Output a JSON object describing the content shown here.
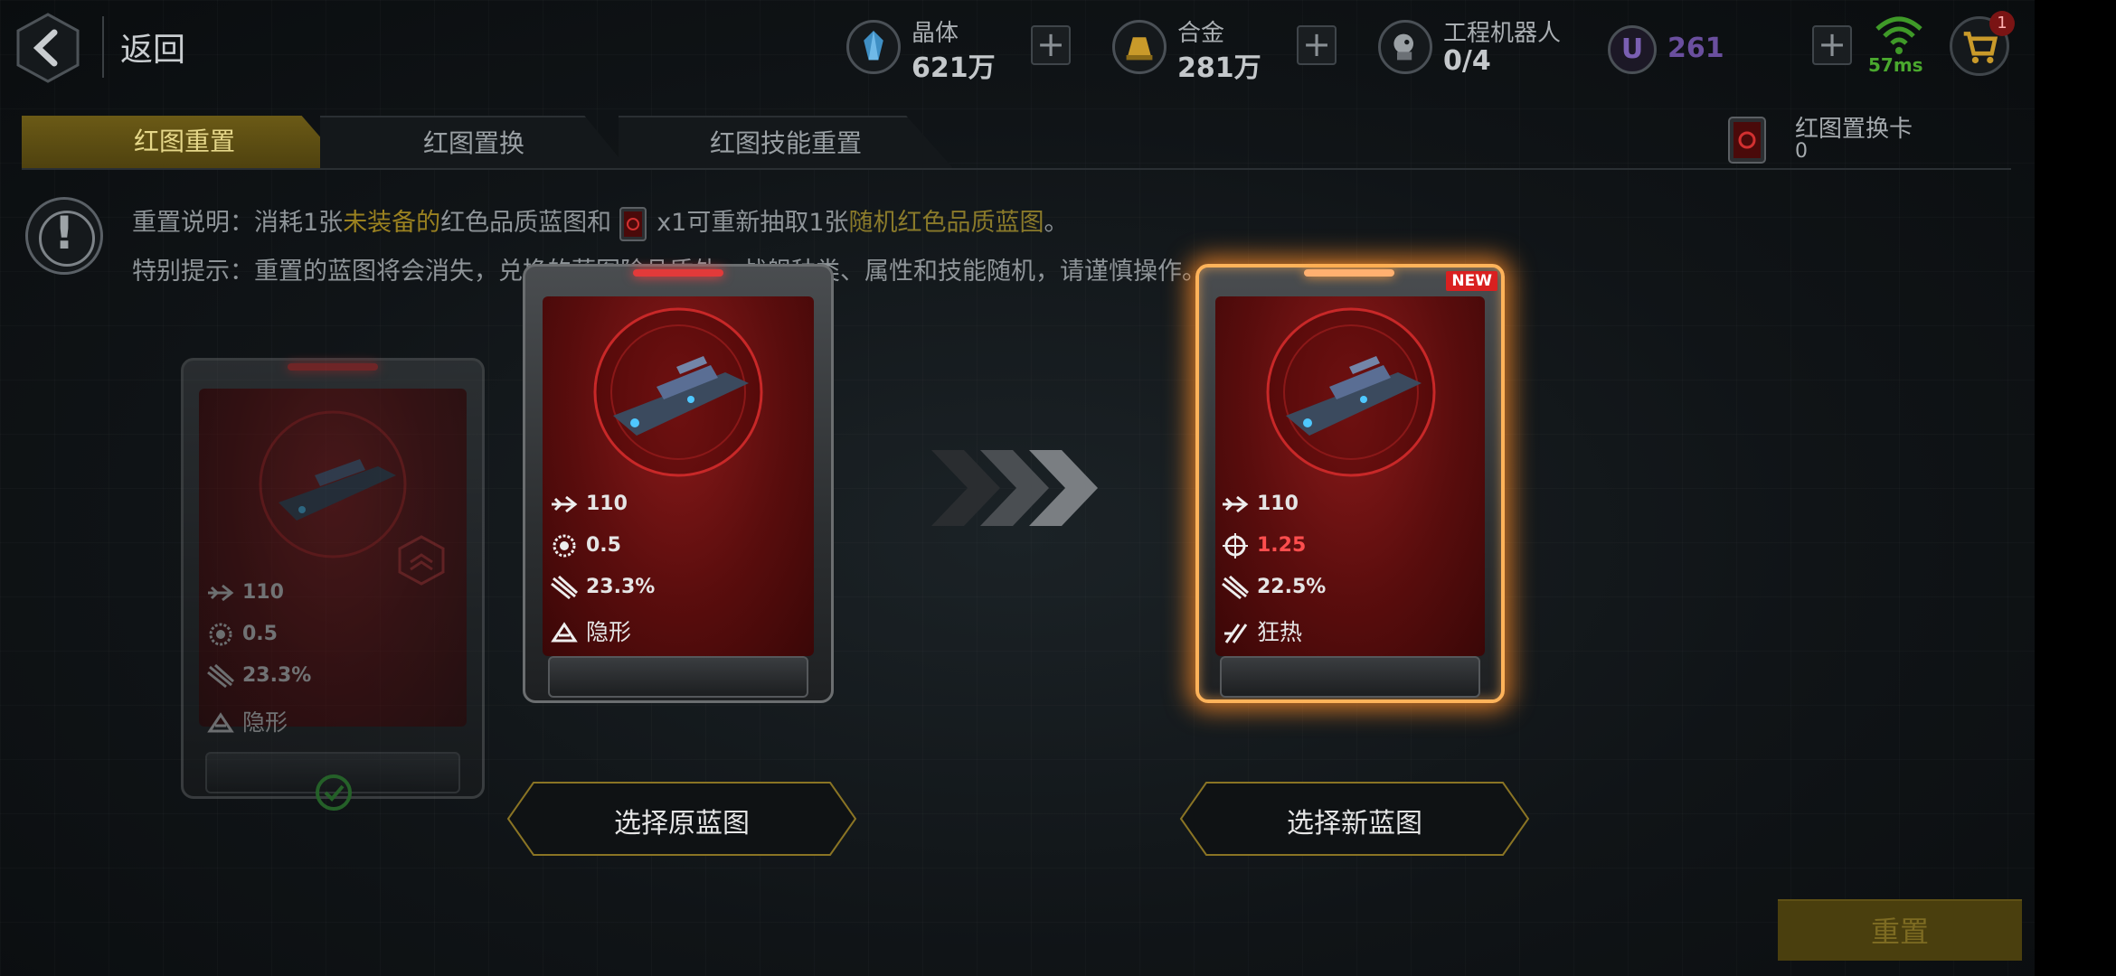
{
  "header": {
    "back_label": "返回",
    "resources": [
      {
        "name": "晶体",
        "value": "621万",
        "icon": "crystal-icon"
      },
      {
        "name": "合金",
        "value": "281万",
        "icon": "alloy-icon"
      },
      {
        "name": "工程机器人",
        "value": "0/4",
        "icon": "robot-icon"
      }
    ],
    "u_currency": {
      "symbol": "U",
      "value": "261"
    },
    "ping": "57ms",
    "cart_badge": "1"
  },
  "tabs": [
    {
      "label": "红图重置",
      "active": true
    },
    {
      "label": "红图置换",
      "active": false
    },
    {
      "label": "红图技能重置",
      "active": false
    }
  ],
  "swap_card": {
    "label": "红图置换卡",
    "count": "0"
  },
  "info": {
    "line1": {
      "prefix": "重置说明：消耗1张",
      "hl1": "未装备的",
      "mid": "红色品质蓝图和",
      "qty": "x1可重新抽取1张",
      "hl2": "随机红色品质蓝图",
      "end": "。"
    },
    "line2": "特别提示：重置的蓝图将会消失，兑换的蓝图除品质外，战舰种类、属性和技能随机，请谨慎操作。"
  },
  "cards": {
    "equipped": {
      "stats": [
        {
          "icon": "speed-arrow-icon",
          "value": "110"
        },
        {
          "icon": "gear-ring-icon",
          "value": "0.5"
        },
        {
          "icon": "missile-icon",
          "value": "23.3%"
        },
        {
          "icon": "stealth-skill-icon",
          "value": "隐形"
        }
      ]
    },
    "original": {
      "stats": [
        {
          "icon": "speed-arrow-icon",
          "value": "110"
        },
        {
          "icon": "gear-ring-icon",
          "value": "0.5"
        },
        {
          "icon": "missile-icon",
          "value": "23.3%"
        },
        {
          "icon": "stealth-skill-icon",
          "value": "隐形"
        }
      ]
    },
    "new": {
      "badge": "NEW",
      "stats": [
        {
          "icon": "speed-arrow-icon",
          "value": "110"
        },
        {
          "icon": "crosshair-icon",
          "value": "1.25"
        },
        {
          "icon": "missile-icon",
          "value": "22.5%"
        },
        {
          "icon": "frenzy-skill-icon",
          "value": "狂热"
        }
      ]
    }
  },
  "buttons": {
    "select_original": "选择原蓝图",
    "select_new": "选择新蓝图",
    "reset": "重置"
  },
  "colors": {
    "accent_gold": "#9a8120",
    "card_red": "#8a1a1a",
    "glow_orange": "#ffb35a",
    "stat_red": "#ff4e4e"
  }
}
